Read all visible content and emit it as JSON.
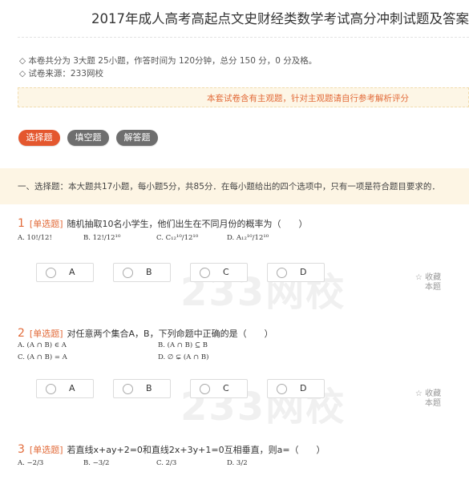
{
  "page": {
    "title": "2017年成人高考高起点文史财经类数学考试高分冲刺试题及答案",
    "info_line1": "◇ 本卷共分为 3大题 25小题，作答时间为 120分钟，总分 150 分，0 分及格。",
    "info_line2": "◇ 试卷来源：233网校",
    "notice": "本套试卷含有主观题，针对主观题请自行参考解析评分"
  },
  "tabs": [
    {
      "label": "选择题",
      "active": true
    },
    {
      "label": "填空题",
      "active": false
    },
    {
      "label": "解答题",
      "active": false
    }
  ],
  "section": {
    "description": "一、选择题：本大题共17小题，每小题5分，共85分．在每小题给出的四个选项中，只有一项是符合题目要求的．"
  },
  "questions": [
    {
      "number": "1",
      "type": "[单选题]",
      "text": "随机抽取10名小学生，他们出生在不同月份的概率为（　　）",
      "options": [
        "A. 10!/12!",
        "B. 12!/12¹⁰",
        "C. C₁₂¹⁰/12¹⁰",
        "D. A₁₂¹⁰/12¹⁰"
      ],
      "choices": [
        "A",
        "B",
        "C",
        "D"
      ],
      "favorite": [
        "☆ 收藏",
        "本题"
      ]
    },
    {
      "number": "2",
      "type": "[单选题]",
      "text": "对任意两个集合A，B，下列命题中正确的是（　　）",
      "options": [
        "A. (A ∩ B) ∈ A",
        "B. (A ∩ B) ⊆ B",
        "C. (A ∩ B) = A",
        "D. ∅ ⊊ (A ∩ B)"
      ],
      "choices": [
        "A",
        "B",
        "C",
        "D"
      ],
      "favorite": [
        "☆ 收藏",
        "本题"
      ]
    },
    {
      "number": "3",
      "type": "[单选题]",
      "text": "若直线x+ay+2=0和直线2x+3y+1=0互相垂直，则a=（　　）",
      "options": [
        "A. −2/3",
        "B. −3/2",
        "C. 2/3",
        "D. 3/2"
      ]
    }
  ],
  "watermark": "233网校"
}
